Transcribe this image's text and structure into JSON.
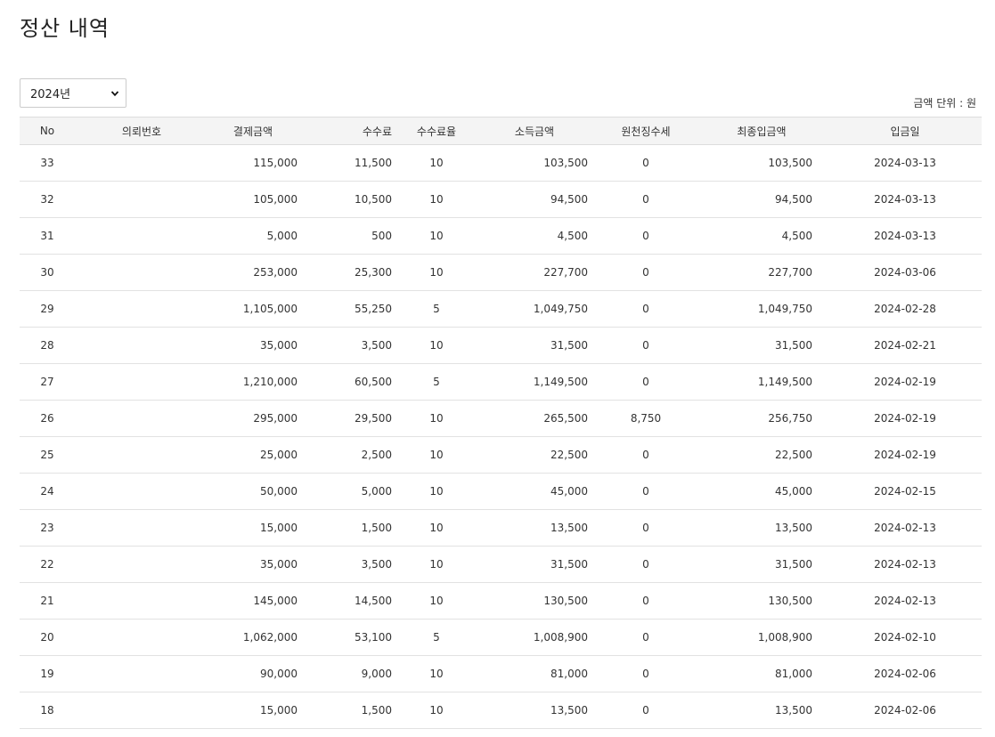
{
  "page": {
    "title": "정산 내역",
    "year_select": {
      "selected": "2024년"
    },
    "unit_note": "금액 단위 : 원"
  },
  "table": {
    "columns": [
      "No",
      "의뢰번호",
      "결제금액",
      "수수료",
      "수수료율",
      "소득금액",
      "원천징수세",
      "최종입금액",
      "입금일"
    ],
    "rows": [
      {
        "no": "33",
        "request_no": "",
        "payment": "115,000",
        "fee": "11,500",
        "rate": "10",
        "income": "103,500",
        "withholding": "0",
        "final": "103,500",
        "date": "2024-03-13"
      },
      {
        "no": "32",
        "request_no": "",
        "payment": "105,000",
        "fee": "10,500",
        "rate": "10",
        "income": "94,500",
        "withholding": "0",
        "final": "94,500",
        "date": "2024-03-13"
      },
      {
        "no": "31",
        "request_no": "",
        "payment": "5,000",
        "fee": "500",
        "rate": "10",
        "income": "4,500",
        "withholding": "0",
        "final": "4,500",
        "date": "2024-03-13"
      },
      {
        "no": "30",
        "request_no": "",
        "payment": "253,000",
        "fee": "25,300",
        "rate": "10",
        "income": "227,700",
        "withholding": "0",
        "final": "227,700",
        "date": "2024-03-06"
      },
      {
        "no": "29",
        "request_no": "",
        "payment": "1,105,000",
        "fee": "55,250",
        "rate": "5",
        "income": "1,049,750",
        "withholding": "0",
        "final": "1,049,750",
        "date": "2024-02-28"
      },
      {
        "no": "28",
        "request_no": "",
        "payment": "35,000",
        "fee": "3,500",
        "rate": "10",
        "income": "31,500",
        "withholding": "0",
        "final": "31,500",
        "date": "2024-02-21"
      },
      {
        "no": "27",
        "request_no": "",
        "payment": "1,210,000",
        "fee": "60,500",
        "rate": "5",
        "income": "1,149,500",
        "withholding": "0",
        "final": "1,149,500",
        "date": "2024-02-19"
      },
      {
        "no": "26",
        "request_no": "",
        "payment": "295,000",
        "fee": "29,500",
        "rate": "10",
        "income": "265,500",
        "withholding": "8,750",
        "final": "256,750",
        "date": "2024-02-19"
      },
      {
        "no": "25",
        "request_no": "",
        "payment": "25,000",
        "fee": "2,500",
        "rate": "10",
        "income": "22,500",
        "withholding": "0",
        "final": "22,500",
        "date": "2024-02-19"
      },
      {
        "no": "24",
        "request_no": "",
        "payment": "50,000",
        "fee": "5,000",
        "rate": "10",
        "income": "45,000",
        "withholding": "0",
        "final": "45,000",
        "date": "2024-02-15"
      },
      {
        "no": "23",
        "request_no": "",
        "payment": "15,000",
        "fee": "1,500",
        "rate": "10",
        "income": "13,500",
        "withholding": "0",
        "final": "13,500",
        "date": "2024-02-13"
      },
      {
        "no": "22",
        "request_no": "",
        "payment": "35,000",
        "fee": "3,500",
        "rate": "10",
        "income": "31,500",
        "withholding": "0",
        "final": "31,500",
        "date": "2024-02-13"
      },
      {
        "no": "21",
        "request_no": "",
        "payment": "145,000",
        "fee": "14,500",
        "rate": "10",
        "income": "130,500",
        "withholding": "0",
        "final": "130,500",
        "date": "2024-02-13"
      },
      {
        "no": "20",
        "request_no": "",
        "payment": "1,062,000",
        "fee": "53,100",
        "rate": "5",
        "income": "1,008,900",
        "withholding": "0",
        "final": "1,008,900",
        "date": "2024-02-10"
      },
      {
        "no": "19",
        "request_no": "",
        "payment": "90,000",
        "fee": "9,000",
        "rate": "10",
        "income": "81,000",
        "withholding": "0",
        "final": "81,000",
        "date": "2024-02-06"
      },
      {
        "no": "18",
        "request_no": "",
        "payment": "15,000",
        "fee": "1,500",
        "rate": "10",
        "income": "13,500",
        "withholding": "0",
        "final": "13,500",
        "date": "2024-02-06"
      }
    ]
  },
  "icons": {
    "select_caret": "chevron-down-icon"
  }
}
